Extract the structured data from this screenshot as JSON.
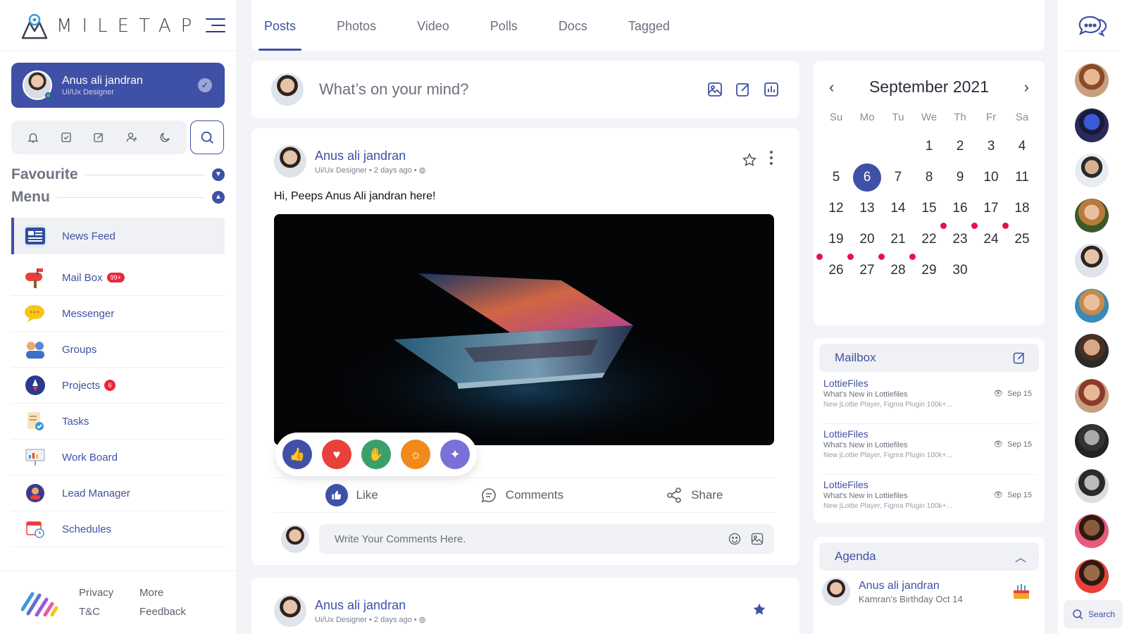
{
  "brand": {
    "name": "MILETAP"
  },
  "profile": {
    "name": "Anus ali jandran",
    "role": "Ui/Ux Designer"
  },
  "quick_icons": [
    "bell-icon",
    "checkbox-icon",
    "edit-icon",
    "add-user-icon",
    "moon-icon"
  ],
  "sections": {
    "favourite": "Favourite",
    "menu": "Menu"
  },
  "menu": [
    {
      "label": "News Feed",
      "icon": "newsfeed-icon",
      "active": true
    },
    {
      "label": "Mail Box",
      "icon": "mailbox-icon",
      "badge": "99+"
    },
    {
      "label": "Messenger",
      "icon": "messenger-icon"
    },
    {
      "label": "Groups",
      "icon": "groups-icon"
    },
    {
      "label": "Projects",
      "icon": "projects-icon",
      "badge": "6"
    },
    {
      "label": "Tasks",
      "icon": "tasks-icon"
    },
    {
      "label": "Work Board",
      "icon": "workboard-icon"
    },
    {
      "label": "Lead Manager",
      "icon": "lead-manager-icon"
    },
    {
      "label": "Schedules",
      "icon": "schedules-icon"
    }
  ],
  "footer": {
    "privacy": "Privacy",
    "more": "More",
    "tc": "T&C",
    "feedback": "Feedback"
  },
  "tabs": [
    "Posts",
    "Photos",
    "Video",
    "Polls",
    "Docs",
    "Tagged"
  ],
  "composer": {
    "placeholder": "What’s on your mind?"
  },
  "post": {
    "author": "Anus ali jandran",
    "meta": "Ui/Ux Designer • 2 days ago •",
    "text": "Hi, Peeps Anus Ali jandran here!",
    "actions": {
      "like": "Like",
      "comments": "Comments",
      "share": "Share"
    },
    "comment_placeholder": "Write Your Comments Here."
  },
  "post2": {
    "author": "Anus ali jandran",
    "meta": "Ui/Ux Designer • 2 days ago •"
  },
  "calendar": {
    "title": "September 2021",
    "dows": [
      "Su",
      "Mo",
      "Tu",
      "We",
      "Th",
      "Fr",
      "Sa"
    ],
    "leading_blanks": 3,
    "days": 30,
    "selected": 6,
    "event_days": [
      23,
      24,
      25,
      26,
      27,
      28,
      29
    ]
  },
  "mailbox": {
    "title": "Mailbox",
    "items": [
      {
        "from": "LottieFiles",
        "subject": "What's New in Lottiefiles",
        "preview": "New jLottie Player, Figma Plugin 100k+...",
        "date": "Sep 15"
      },
      {
        "from": "LottieFiles",
        "subject": "What's New in Lottiefiles",
        "preview": "New jLottie Player, Figma Plugin 100k+...",
        "date": "Sep 15"
      },
      {
        "from": "LottieFiles",
        "subject": "What's New in Lottiefiles",
        "preview": "New jLottie Player, Figma Plugin 100k+...",
        "date": "Sep 15"
      }
    ]
  },
  "agenda": {
    "title": "Agenda",
    "name": "Anus ali jandran",
    "sub": "Kamran's Birthday Oct 14"
  },
  "rail": {
    "search": "Search"
  },
  "colors": {
    "accent": "#3f51a6",
    "event": "#e5124a",
    "badge": "#e8283c"
  }
}
